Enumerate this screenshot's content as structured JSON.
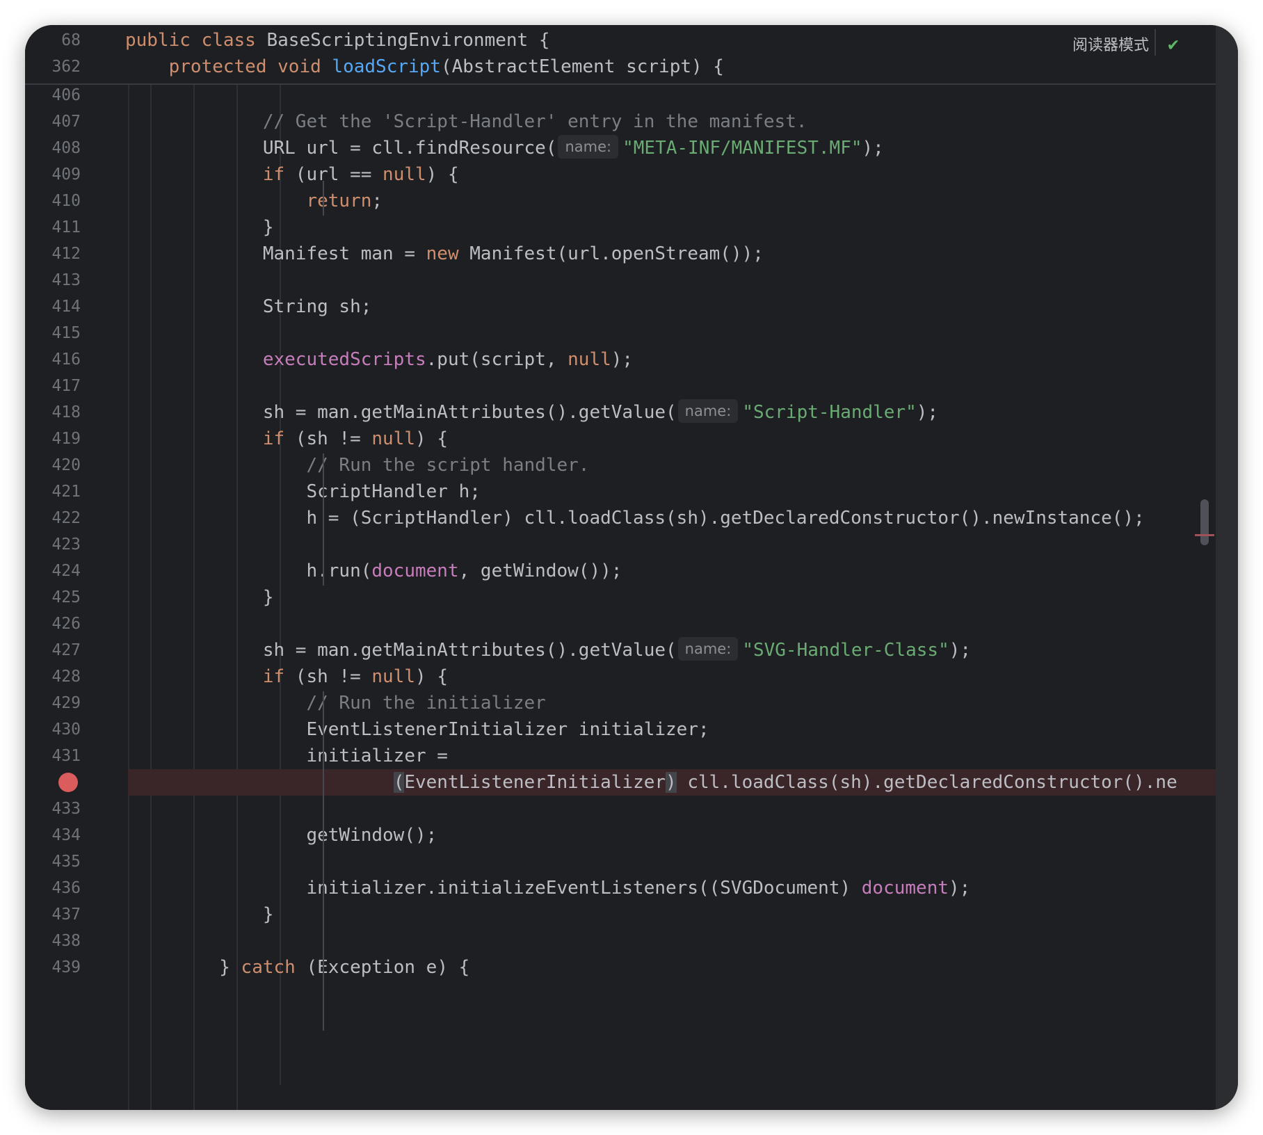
{
  "toolbar": {
    "reader_mode_label": "阅读器模式",
    "check_icon": "check-icon",
    "check_glyph": "✔"
  },
  "sticky": [
    {
      "line": "68",
      "parts": [
        {
          "t": "public class ",
          "c": "kw"
        },
        {
          "t": "BaseScriptingEnvironment {",
          "c": ""
        }
      ]
    },
    {
      "line": "362",
      "parts": [
        {
          "t": "    protected void ",
          "c": "kw"
        },
        {
          "t": "loadScript",
          "c": "fn"
        },
        {
          "t": "(AbstractElement script) {",
          "c": ""
        }
      ]
    }
  ],
  "lines": [
    {
      "line": "406",
      "parts": []
    },
    {
      "line": "407",
      "parts": [
        {
          "t": "            // Get the 'Script-Handler' entry in the manifest.",
          "c": "cmt"
        }
      ]
    },
    {
      "line": "408",
      "parts": [
        {
          "t": "            URL url = cll.findResource(",
          "c": ""
        },
        {
          "hint": "name:"
        },
        {
          "t": "\"META-INF/MANIFEST.MF\"",
          "c": "str"
        },
        {
          "t": ");",
          "c": ""
        }
      ]
    },
    {
      "line": "409",
      "parts": [
        {
          "t": "            ",
          "c": ""
        },
        {
          "t": "if",
          "c": "kw"
        },
        {
          "t": " (url == ",
          "c": ""
        },
        {
          "t": "null",
          "c": "kw"
        },
        {
          "t": ") {",
          "c": ""
        }
      ]
    },
    {
      "line": "410",
      "parts": [
        {
          "t": "                ",
          "c": ""
        },
        {
          "t": "return",
          "c": "kw"
        },
        {
          "t": ";",
          "c": ""
        }
      ]
    },
    {
      "line": "411",
      "parts": [
        {
          "t": "            }",
          "c": ""
        }
      ]
    },
    {
      "line": "412",
      "parts": [
        {
          "t": "            Manifest man = ",
          "c": ""
        },
        {
          "t": "new",
          "c": "kw"
        },
        {
          "t": " Manifest(url.openStream());",
          "c": ""
        }
      ]
    },
    {
      "line": "413",
      "parts": []
    },
    {
      "line": "414",
      "parts": [
        {
          "t": "            String sh;",
          "c": ""
        }
      ]
    },
    {
      "line": "415",
      "parts": []
    },
    {
      "line": "416",
      "parts": [
        {
          "t": "            ",
          "c": ""
        },
        {
          "t": "executedScripts",
          "c": "fld"
        },
        {
          "t": ".put(script, ",
          "c": ""
        },
        {
          "t": "null",
          "c": "kw"
        },
        {
          "t": ");",
          "c": ""
        }
      ]
    },
    {
      "line": "417",
      "parts": []
    },
    {
      "line": "418",
      "parts": [
        {
          "t": "            sh = man.getMainAttributes().getValue(",
          "c": ""
        },
        {
          "hint": "name:"
        },
        {
          "t": "\"Script-Handler\"",
          "c": "str"
        },
        {
          "t": ");",
          "c": ""
        }
      ]
    },
    {
      "line": "419",
      "parts": [
        {
          "t": "            ",
          "c": ""
        },
        {
          "t": "if",
          "c": "kw"
        },
        {
          "t": " (sh != ",
          "c": ""
        },
        {
          "t": "null",
          "c": "kw"
        },
        {
          "t": ") {",
          "c": ""
        }
      ]
    },
    {
      "line": "420",
      "parts": [
        {
          "t": "                // Run the script handler.",
          "c": "cmt"
        }
      ]
    },
    {
      "line": "421",
      "parts": [
        {
          "t": "                ScriptHandler h;",
          "c": ""
        }
      ]
    },
    {
      "line": "422",
      "parts": [
        {
          "t": "                h = (ScriptHandler) cll.loadClass(sh).getDeclaredConstructor().newInstance();",
          "c": ""
        }
      ]
    },
    {
      "line": "423",
      "parts": []
    },
    {
      "line": "424",
      "parts": [
        {
          "t": "                h.run(",
          "c": ""
        },
        {
          "t": "document",
          "c": "fld"
        },
        {
          "t": ", getWindow());",
          "c": ""
        }
      ]
    },
    {
      "line": "425",
      "parts": [
        {
          "t": "            }",
          "c": ""
        }
      ]
    },
    {
      "line": "426",
      "parts": []
    },
    {
      "line": "427",
      "parts": [
        {
          "t": "            sh = man.getMainAttributes().getValue(",
          "c": ""
        },
        {
          "hint": "name:"
        },
        {
          "t": "\"SVG-Handler-Class\"",
          "c": "str"
        },
        {
          "t": ");",
          "c": ""
        }
      ]
    },
    {
      "line": "428",
      "parts": [
        {
          "t": "            ",
          "c": ""
        },
        {
          "t": "if",
          "c": "kw"
        },
        {
          "t": " (sh != ",
          "c": ""
        },
        {
          "t": "null",
          "c": "kw"
        },
        {
          "t": ") {",
          "c": ""
        }
      ]
    },
    {
      "line": "429",
      "parts": [
        {
          "t": "                // Run the initializer",
          "c": "cmt"
        }
      ]
    },
    {
      "line": "430",
      "parts": [
        {
          "t": "                EventListenerInitializer initializer;",
          "c": ""
        }
      ]
    },
    {
      "line": "431",
      "parts": [
        {
          "t": "                initializer =",
          "c": ""
        }
      ]
    },
    {
      "line": "",
      "breakpoint": true,
      "parts": [
        {
          "t": "                        ",
          "c": ""
        },
        {
          "t": "(",
          "c": "hl-paren"
        },
        {
          "t": "EventListenerInitializer",
          "c": ""
        },
        {
          "t": ")",
          "c": "hl-paren"
        },
        {
          "t": " cll.loadClass(sh).getDeclaredConstructor().ne",
          "c": ""
        }
      ]
    },
    {
      "line": "433",
      "parts": []
    },
    {
      "line": "434",
      "parts": [
        {
          "t": "                getWindow();",
          "c": ""
        }
      ]
    },
    {
      "line": "435",
      "parts": []
    },
    {
      "line": "436",
      "parts": [
        {
          "t": "                initializer.initializeEventListeners((SVGDocument) ",
          "c": ""
        },
        {
          "t": "document",
          "c": "fld"
        },
        {
          "t": ");",
          "c": ""
        }
      ]
    },
    {
      "line": "437",
      "parts": [
        {
          "t": "            }",
          "c": ""
        }
      ]
    },
    {
      "line": "438",
      "parts": []
    },
    {
      "line": "439",
      "parts": [
        {
          "t": "        } ",
          "c": ""
        },
        {
          "t": "catch",
          "c": "kw"
        },
        {
          "t": " (Exception e) {",
          "c": ""
        }
      ]
    }
  ],
  "icons": {
    "breakpoint": "breakpoint-icon"
  }
}
